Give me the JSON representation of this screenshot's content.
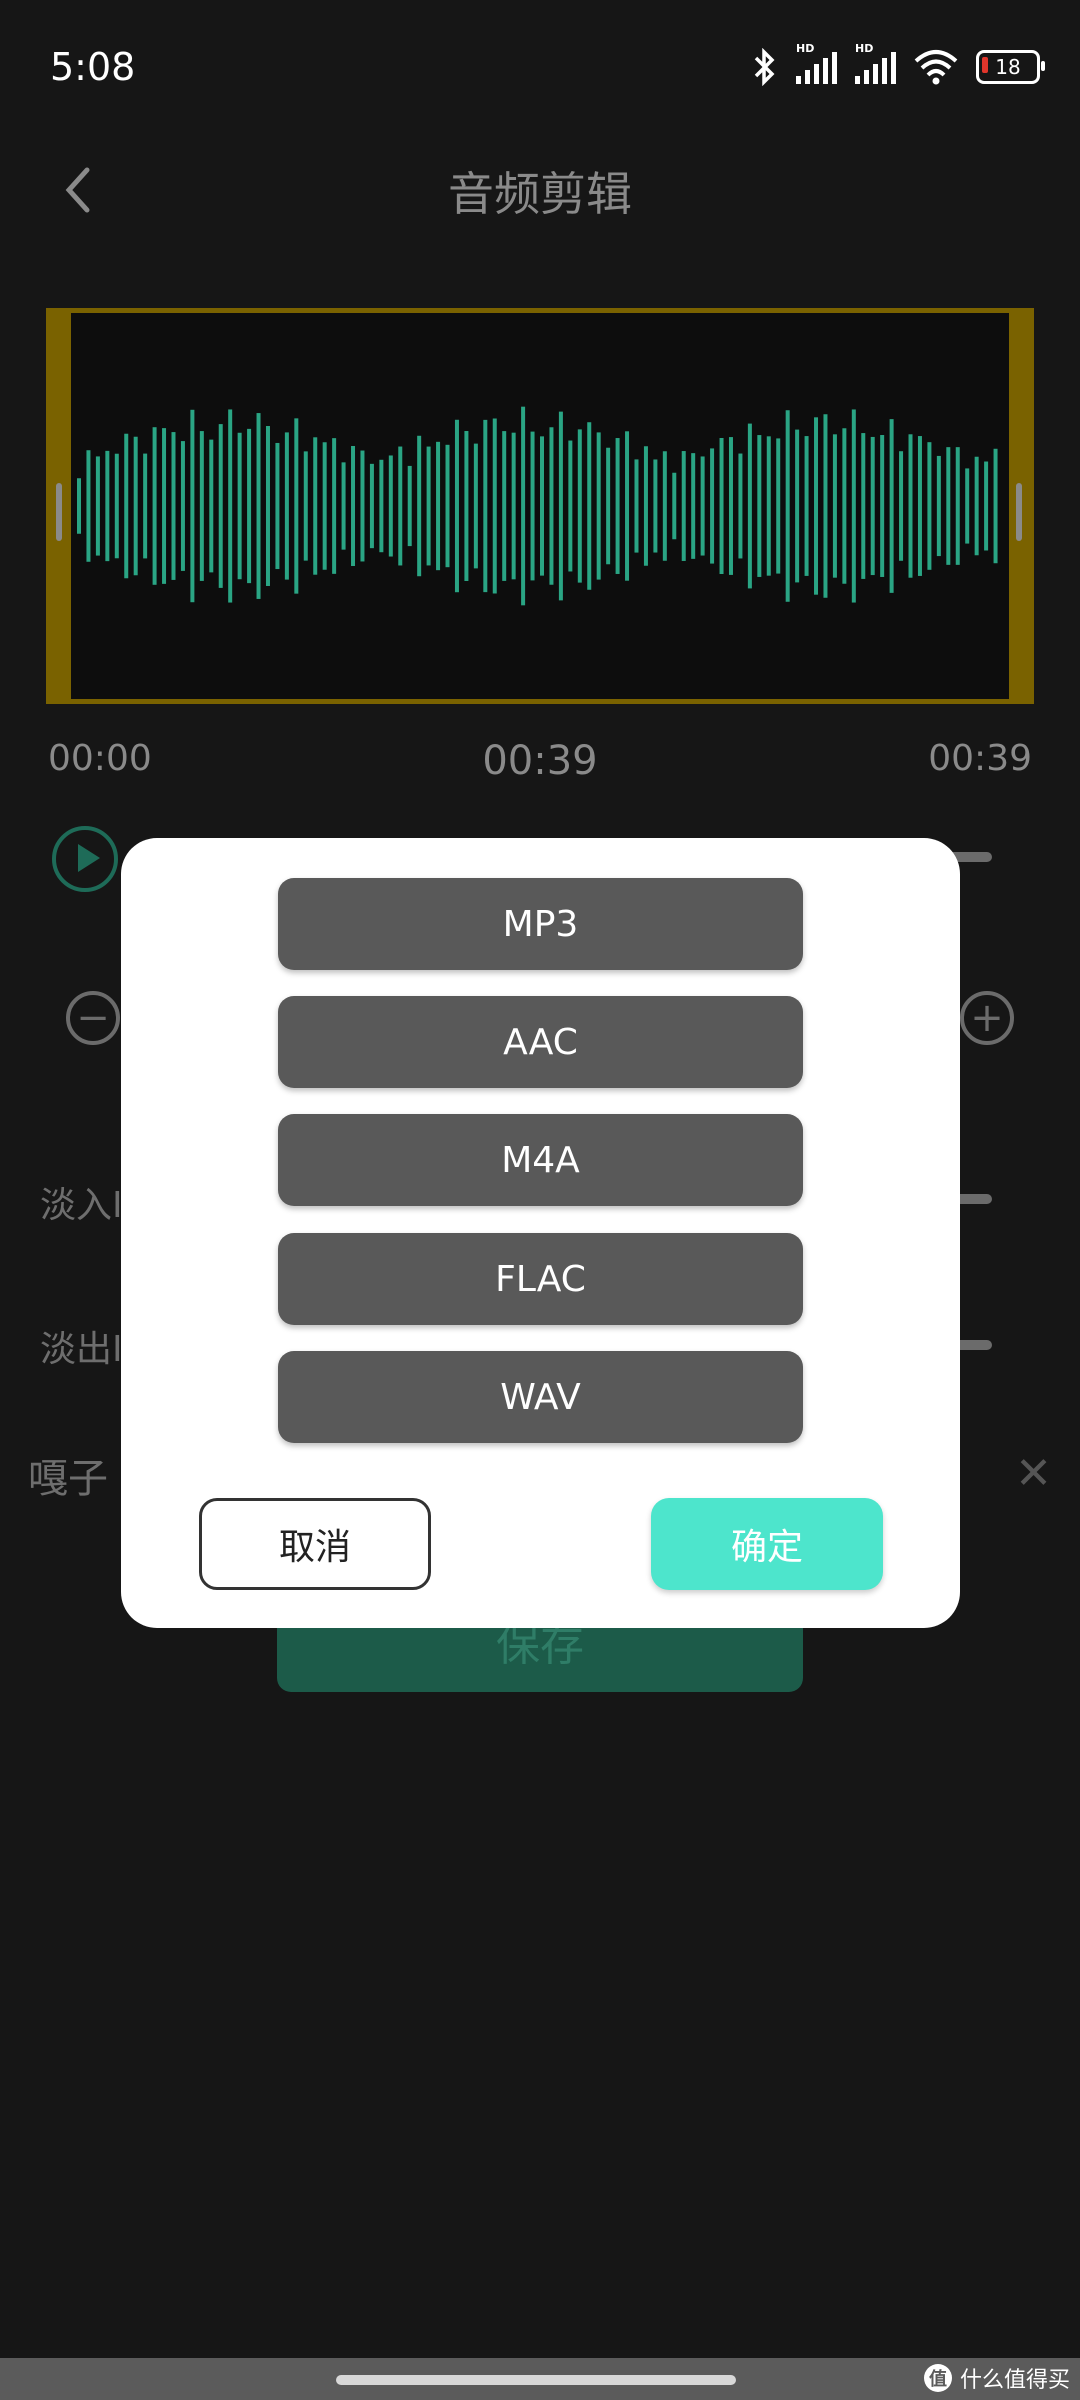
{
  "status_bar": {
    "time": "5:08",
    "battery": "18",
    "network_label": "HD"
  },
  "header": {
    "title": "音频剪辑"
  },
  "timeline": {
    "start": "00:00",
    "current": "00:39",
    "end": "00:39"
  },
  "background": {
    "fade_in_label": "淡入I",
    "fade_out_label": "淡出I",
    "file_name": "嘎子",
    "save_label": "保存"
  },
  "dialog": {
    "formats": [
      "MP3",
      "AAC",
      "M4A",
      "FLAC",
      "WAV"
    ],
    "cancel_label": "取消",
    "confirm_label": "确定"
  },
  "watermark": {
    "logo": "值",
    "text": "什么值得买"
  },
  "colors": {
    "accent": "#4de5cc",
    "waveform": "#2aa584",
    "trim_border": "#7a6200"
  }
}
